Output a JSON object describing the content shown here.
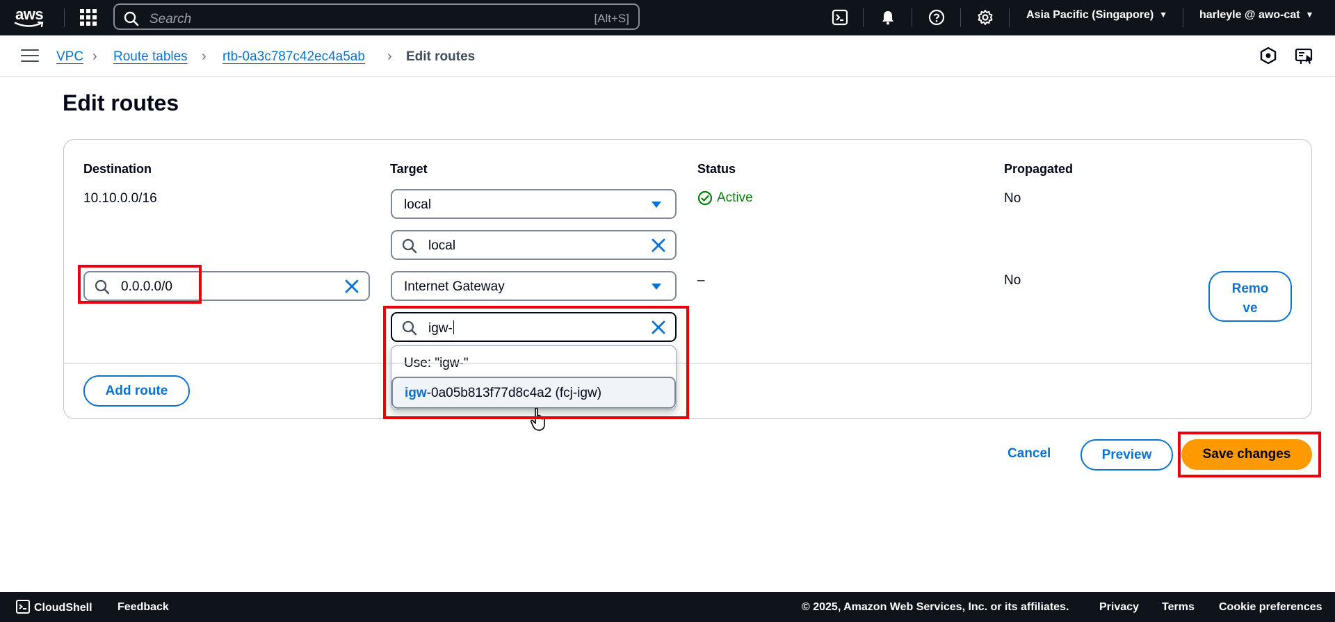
{
  "topnav": {
    "logo_text": "aws",
    "search_placeholder": "Search",
    "search_shortcut": "[Alt+S]",
    "region": "Asia Pacific (Singapore)",
    "user": "harleyle @ awo-cat"
  },
  "breadcrumb": {
    "items": [
      "VPC",
      "Route tables",
      "rtb-0a3c787c42ec4a5ab"
    ],
    "current": "Edit routes"
  },
  "page": {
    "title": "Edit routes"
  },
  "routes": {
    "headers": [
      "Destination",
      "Target",
      "Status",
      "Propagated"
    ],
    "row1": {
      "destination": "10.10.0.0/16",
      "target": "local",
      "target_filter": "local",
      "status": "Active",
      "propagated": "No"
    },
    "row2": {
      "destination": "0.0.0.0/0",
      "target": "Internet Gateway",
      "target_filter": "igw-",
      "status": "–",
      "propagated": "No",
      "remove_label_1": "Remo",
      "remove_label_2": "ve"
    },
    "dropdown": {
      "use_option": "Use: \"igw-\"",
      "match_highlight": "igw",
      "match_rest": "-0a05b813f77d8c4a2 (fcj-igw)"
    },
    "add_route_label": "Add route"
  },
  "actions": {
    "cancel": "Cancel",
    "preview": "Preview",
    "save": "Save changes"
  },
  "footer": {
    "cloudshell": "CloudShell",
    "feedback": "Feedback",
    "copyright": "© 2025, Amazon Web Services, Inc. or its affiliates.",
    "privacy": "Privacy",
    "terms": "Terms",
    "cookie": "Cookie preferences"
  },
  "colors": {
    "nav_bg": "#0f141a",
    "link": "#0972d3",
    "primary": "#ff9900",
    "active": "#037f0c",
    "highlight_box": "#e8000b"
  }
}
